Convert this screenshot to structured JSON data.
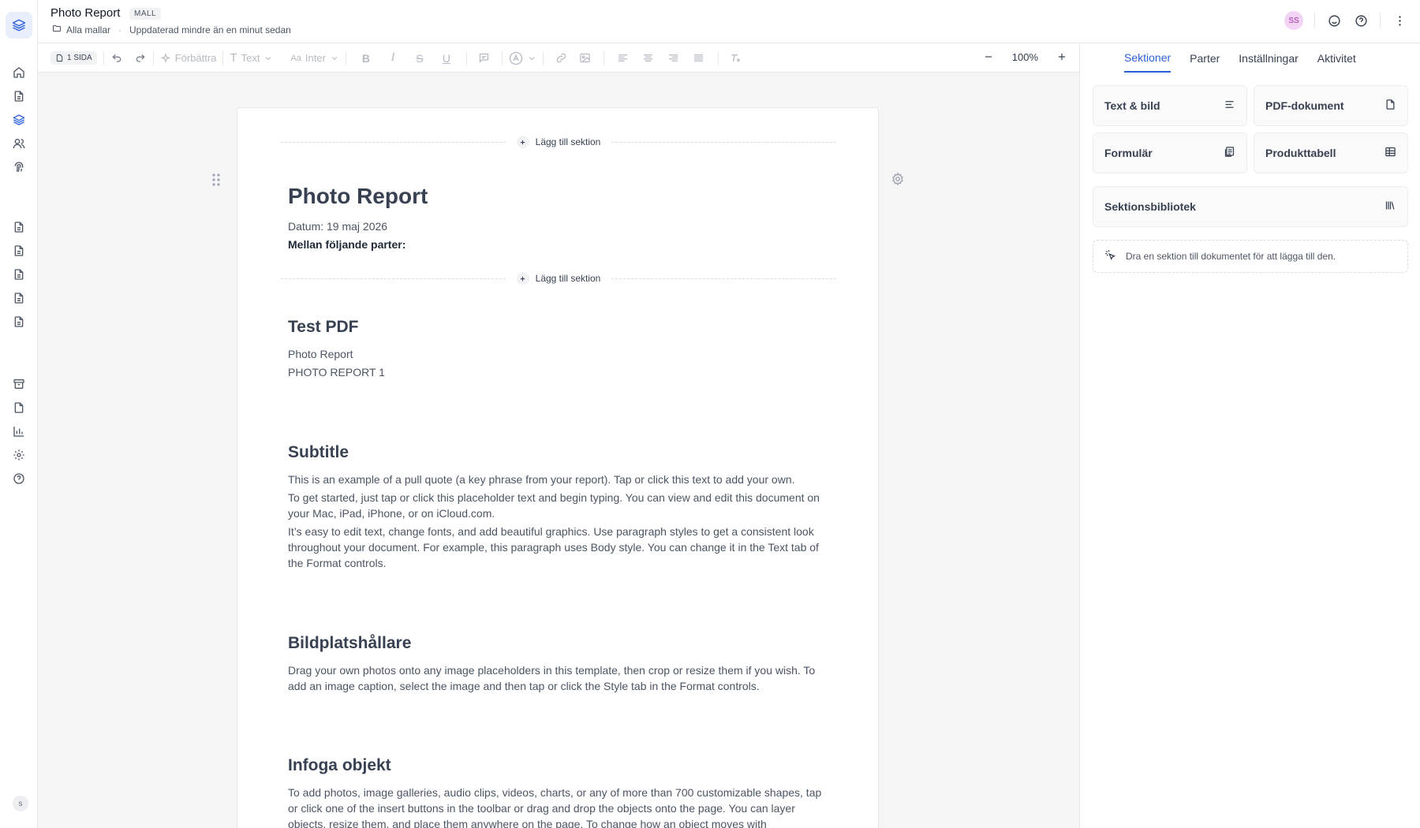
{
  "header": {
    "title": "Photo Report",
    "badge": "MALL",
    "breadcrumb_link": "Alla mallar",
    "updated": "Uppdaterad mindre än en minut sedan",
    "user_initials": "SS"
  },
  "rail": {
    "bottom_initial": "s"
  },
  "toolbar": {
    "pages": "1 SIDA",
    "improve": "Förbättra",
    "text_style": "Text",
    "font": "Inter",
    "zoom": "100%"
  },
  "document": {
    "add_section": "Lägg till sektion",
    "title": "Photo Report",
    "date_line": "Datum: 19 maj 2026",
    "parties_line": "Mellan följande parter:",
    "sections": [
      {
        "heading": "Test PDF",
        "paragraphs": [
          "Photo Report",
          "PHOTO REPORT 1"
        ]
      },
      {
        "heading": "Subtitle",
        "paragraphs": [
          "This is an example of a pull quote (a key phrase from your report). Tap or click this text to add your own.",
          "To get started, just tap or click this placeholder text and begin typing. You can view and edit this document on your Mac, iPad, iPhone, or on iCloud.com.",
          "It’s easy to edit text, change fonts, and add beautiful graphics. Use paragraph styles to get a consistent look throughout your document. For example, this paragraph uses Body style. You can change it in the Text tab of the Format controls."
        ]
      },
      {
        "heading": "Bildplatshållare",
        "paragraphs": [
          "Drag your own photos onto any image placeholders in this template, then crop or resize them if you wish. To add an image caption, select the image and then tap or click the Style tab in the Format controls."
        ]
      },
      {
        "heading": "Infoga objekt",
        "paragraphs": [
          "To add photos, image galleries, audio clips, videos, charts, or any of more than 700 customizable shapes, tap or click one of the insert buttons in the toolbar or drag and drop the objects onto the page. You can layer objects, resize them, and place them anywhere on the page. To change how an object moves with"
        ]
      }
    ]
  },
  "panel": {
    "tabs": [
      "Sektioner",
      "Parter",
      "Inställningar",
      "Aktivitet"
    ],
    "active_tab": 0,
    "cards": [
      "Text & bild",
      "PDF-dokument",
      "Formulär",
      "Produkttabell",
      "Sektionsbibliotek"
    ],
    "hint": "Dra en sektion till dokumentet för att lägga till den."
  },
  "colors": {
    "accent": "#2b5fd9",
    "avatar_bg": "#f3d4f4",
    "avatar_text": "#a12ba6"
  }
}
